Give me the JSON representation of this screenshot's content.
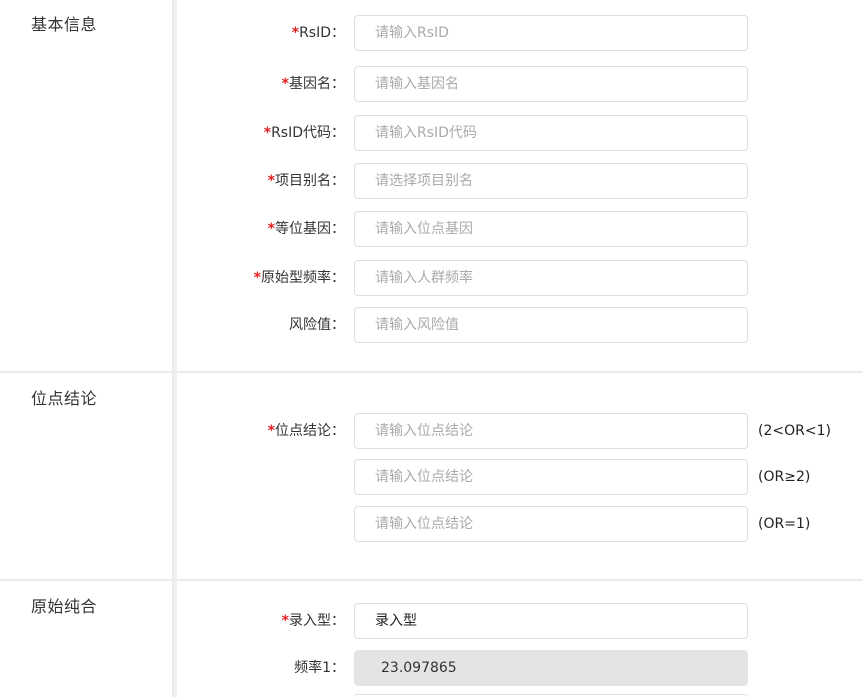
{
  "sections": {
    "basic": {
      "title": "基本信息",
      "fields": [
        {
          "label": "RsID",
          "colon": "：",
          "required": "*",
          "placeholder": "请输入RsID"
        },
        {
          "label": "基因名",
          "colon": "：",
          "required": "*",
          "placeholder": "请输入基因名"
        },
        {
          "label": "RsID代码",
          "colon": "：",
          "required": "*",
          "placeholder": "请输入RsID代码"
        },
        {
          "label": "项目别名",
          "colon": "：",
          "required": "*",
          "placeholder": "请选择项目别名"
        },
        {
          "label": "等位基因",
          "colon": "：",
          "required": "*",
          "placeholder": "请输入位点基因"
        },
        {
          "label": "原始型频率",
          "colon": "：",
          "required": "*",
          "placeholder": "请输入人群频率"
        },
        {
          "label": "风险值",
          "colon": "：",
          "required": "",
          "placeholder": "请输入风险值"
        }
      ]
    },
    "conclusion": {
      "title": "位点结论",
      "label": "位点结论",
      "colon": "：",
      "required": "*",
      "inputs": [
        {
          "placeholder": "请输入位点结论",
          "suffix": "(2<OR<1)"
        },
        {
          "placeholder": "请输入位点结论",
          "suffix": "(OR≥2)"
        },
        {
          "placeholder": "请输入位点结论",
          "suffix": "(OR=1)"
        }
      ]
    },
    "pure": {
      "title": "原始纯合",
      "fields": [
        {
          "label": "录入型",
          "colon": "：",
          "required": "*",
          "value": "录入型"
        },
        {
          "label": "频率1",
          "colon": "：",
          "required": "",
          "value": "23.097865"
        }
      ]
    }
  }
}
